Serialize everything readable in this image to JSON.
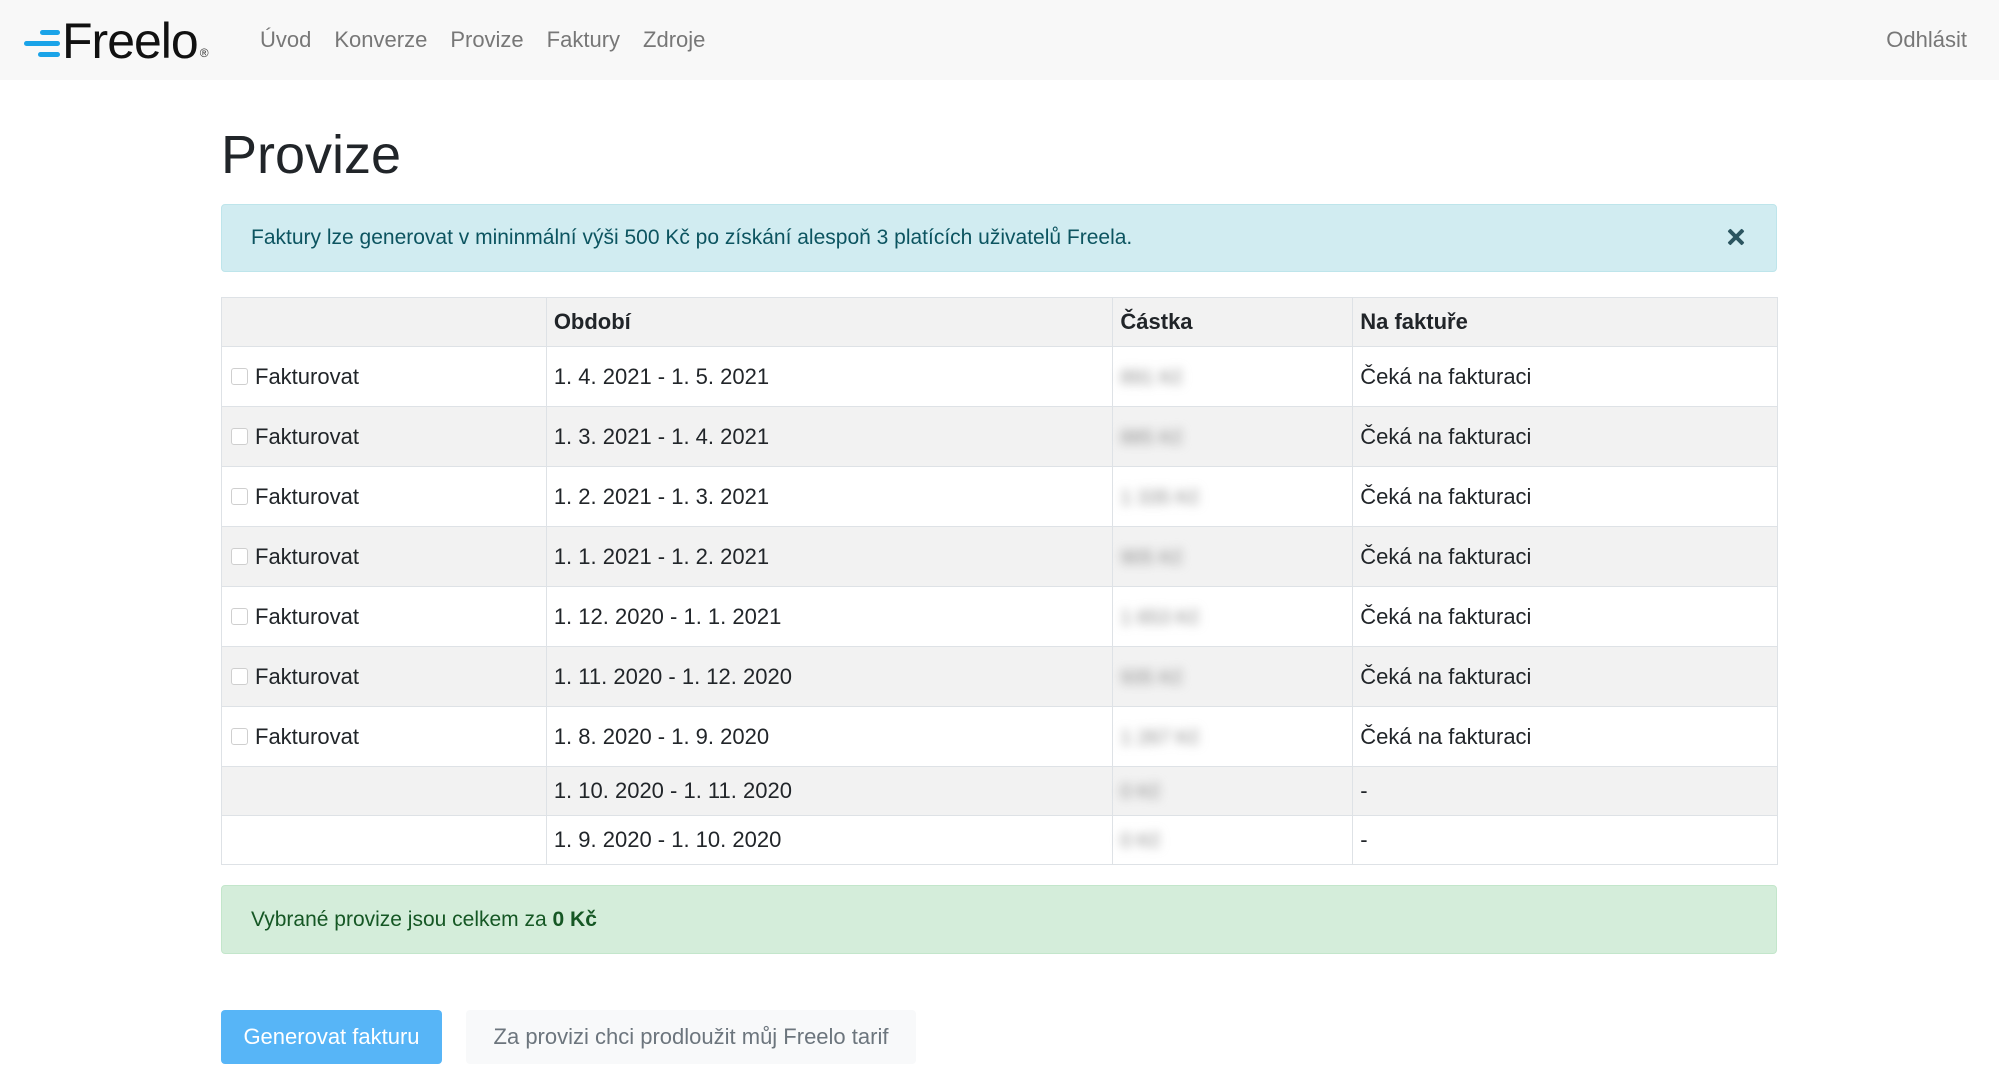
{
  "brand": {
    "logo_text": "Freelo",
    "logo_reg": "®",
    "accent": "#1aa3e8"
  },
  "nav": {
    "items": [
      "Úvod",
      "Konverze",
      "Provize",
      "Faktury",
      "Zdroje"
    ],
    "logout": "Odhlásit"
  },
  "page_title": "Provize",
  "info_alert": {
    "message": "Faktury lze generovat v mininmální výši 500 Kč po získání alespoň 3 platících uživatelů Freela."
  },
  "table": {
    "headers": [
      "",
      "Období",
      "Částka",
      "Na faktuře"
    ],
    "rows": [
      {
        "checkbox_label": "Fakturovat",
        "period": "1. 4. 2021 - 1. 5. 2021",
        "amount": "891 Kč",
        "status": "Čeká na fakturaci"
      },
      {
        "checkbox_label": "Fakturovat",
        "period": "1. 3. 2021 - 1. 4. 2021",
        "amount": "885 Kč",
        "status": "Čeká na fakturaci"
      },
      {
        "checkbox_label": "Fakturovat",
        "period": "1. 2. 2021 - 1. 3. 2021",
        "amount": "1 335 Kč",
        "status": "Čeká na fakturaci"
      },
      {
        "checkbox_label": "Fakturovat",
        "period": "1. 1. 2021 - 1. 2. 2021",
        "amount": "905 Kč",
        "status": "Čeká na fakturaci"
      },
      {
        "checkbox_label": "Fakturovat",
        "period": "1. 12. 2020 - 1. 1. 2021",
        "amount": "1 653 Kč",
        "status": "Čeká na fakturaci"
      },
      {
        "checkbox_label": "Fakturovat",
        "period": "1. 11. 2020 - 1. 12. 2020",
        "amount": "935 Kč",
        "status": "Čeká na fakturaci"
      },
      {
        "checkbox_label": "Fakturovat",
        "period": "1. 8. 2020 - 1. 9. 2020",
        "amount": "1 267 Kč",
        "status": "Čeká na fakturaci"
      },
      {
        "checkbox_label": "",
        "period": "1. 10. 2020 - 1. 11. 2020",
        "amount": "0 Kč",
        "status": "-"
      },
      {
        "checkbox_label": "",
        "period": "1. 9. 2020 - 1. 10. 2020",
        "amount": "0 Kč",
        "status": "-"
      }
    ]
  },
  "success_alert": {
    "prefix": "Vybrané provize jsou celkem za ",
    "total": "0 Kč"
  },
  "buttons": {
    "generate": "Generovat fakturu",
    "extend": "Za provizi chci prodloužit můj Freelo tarif"
  }
}
